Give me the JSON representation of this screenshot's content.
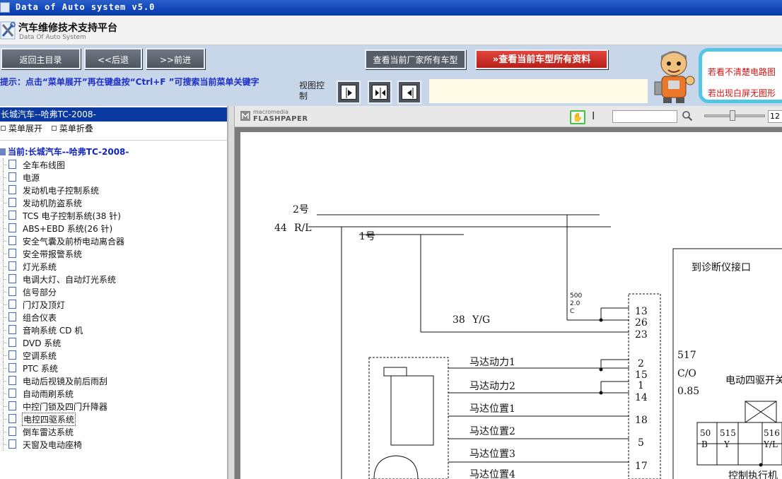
{
  "window": {
    "title": "Data of Auto system v5.0"
  },
  "header": {
    "title": "汽车维修技术支持平台",
    "subtitle": "Data Of Auto System"
  },
  "toolbar": {
    "home": "返回主目录",
    "back": "<<后退",
    "forward": ">>前进",
    "all_models": "查看当前厂家所有车型",
    "all_docs": "查看当前车型所有资料"
  },
  "hint": {
    "text": "提示：点击“菜单展开”再在键盘按“Ctrl+F ”可搜索当前菜单关键字",
    "view_label": "视图控制"
  },
  "promo": {
    "line1": "若看不清楚电路图",
    "line2": "若出现白屏无图形"
  },
  "sidebar": {
    "model": "长城汽车--哈弗TC-2008-",
    "expand": "菜单展开",
    "collapse": "菜单折叠",
    "current": "当前:长城汽车--哈弗TC-2008-",
    "items": [
      "全车布线图",
      "电源",
      "发动机电子控制系统",
      "发动机防盗系统",
      "TCS 电子控制系统(38 针)",
      "ABS+EBD 系统(26 针)",
      "安全气囊及前桥电动离合器",
      "安全带报警系统",
      "灯光系统",
      "电调大灯、自动灯光系统",
      "信号部分",
      "门灯及顶灯",
      "组合仪表",
      "音响系统 CD 机",
      "DVD 系统",
      "空调系统",
      "PTC 系统",
      "电动后视镜及前后雨刮",
      "自动雨刷系统",
      "中控门锁及四门升降器",
      "电控四驱系统",
      "倒车雷达系统",
      "天窗及电动座椅"
    ],
    "selected_index": 20
  },
  "viewer": {
    "brand_top": "macromedia",
    "brand_bottom": "FLASHPAPER",
    "zoom_value": "12",
    "diagram": {
      "wire_2": "2号",
      "wire_44": "44",
      "wire_rl": "R/L",
      "wire_1": "1号",
      "wire_38": "38",
      "wire_yg": "Y/G",
      "small_500": "500",
      "small_20": "2.0",
      "small_c": "C",
      "pin_13": "13",
      "pin_26": "26",
      "pin_23": "23",
      "pin_2": "2",
      "pin_15": "15",
      "pin_1": "1",
      "pin_14": "14",
      "pin_18": "18",
      "pin_5": "5",
      "pin_17": "17",
      "motor_power1": "马达动力1",
      "motor_power2": "马达动力2",
      "motor_pos1": "马达位置1",
      "motor_pos2": "马达位置2",
      "motor_pos3": "马达位置3",
      "motor_pos4": "马达位置4",
      "diag_port": "到诊断仪接口",
      "w517": "517",
      "w_co": "C/O",
      "w085": "0.85",
      "elec_switch": "电动四驱开关",
      "c50": "50",
      "c_b": "B",
      "c515": "515",
      "c_y": "Y",
      "c516": "516",
      "c_yl": "Y/L",
      "bottom_text": "控制执行机"
    }
  },
  "colors": {
    "titlebar": "#1246b8",
    "toolbar": "#c8d6ea",
    "selected_model": "#0a3aa1",
    "hint_text": "#1c2fc8",
    "promo_border": "#53c6e6",
    "all_docs_button": "#b81f18"
  },
  "icons": {
    "app": "wrench-screwdriver-icon",
    "hand": "hand-tool-icon",
    "text_select": "text-cursor-icon",
    "find": "magnifier-icon",
    "doc": "document-icon"
  }
}
